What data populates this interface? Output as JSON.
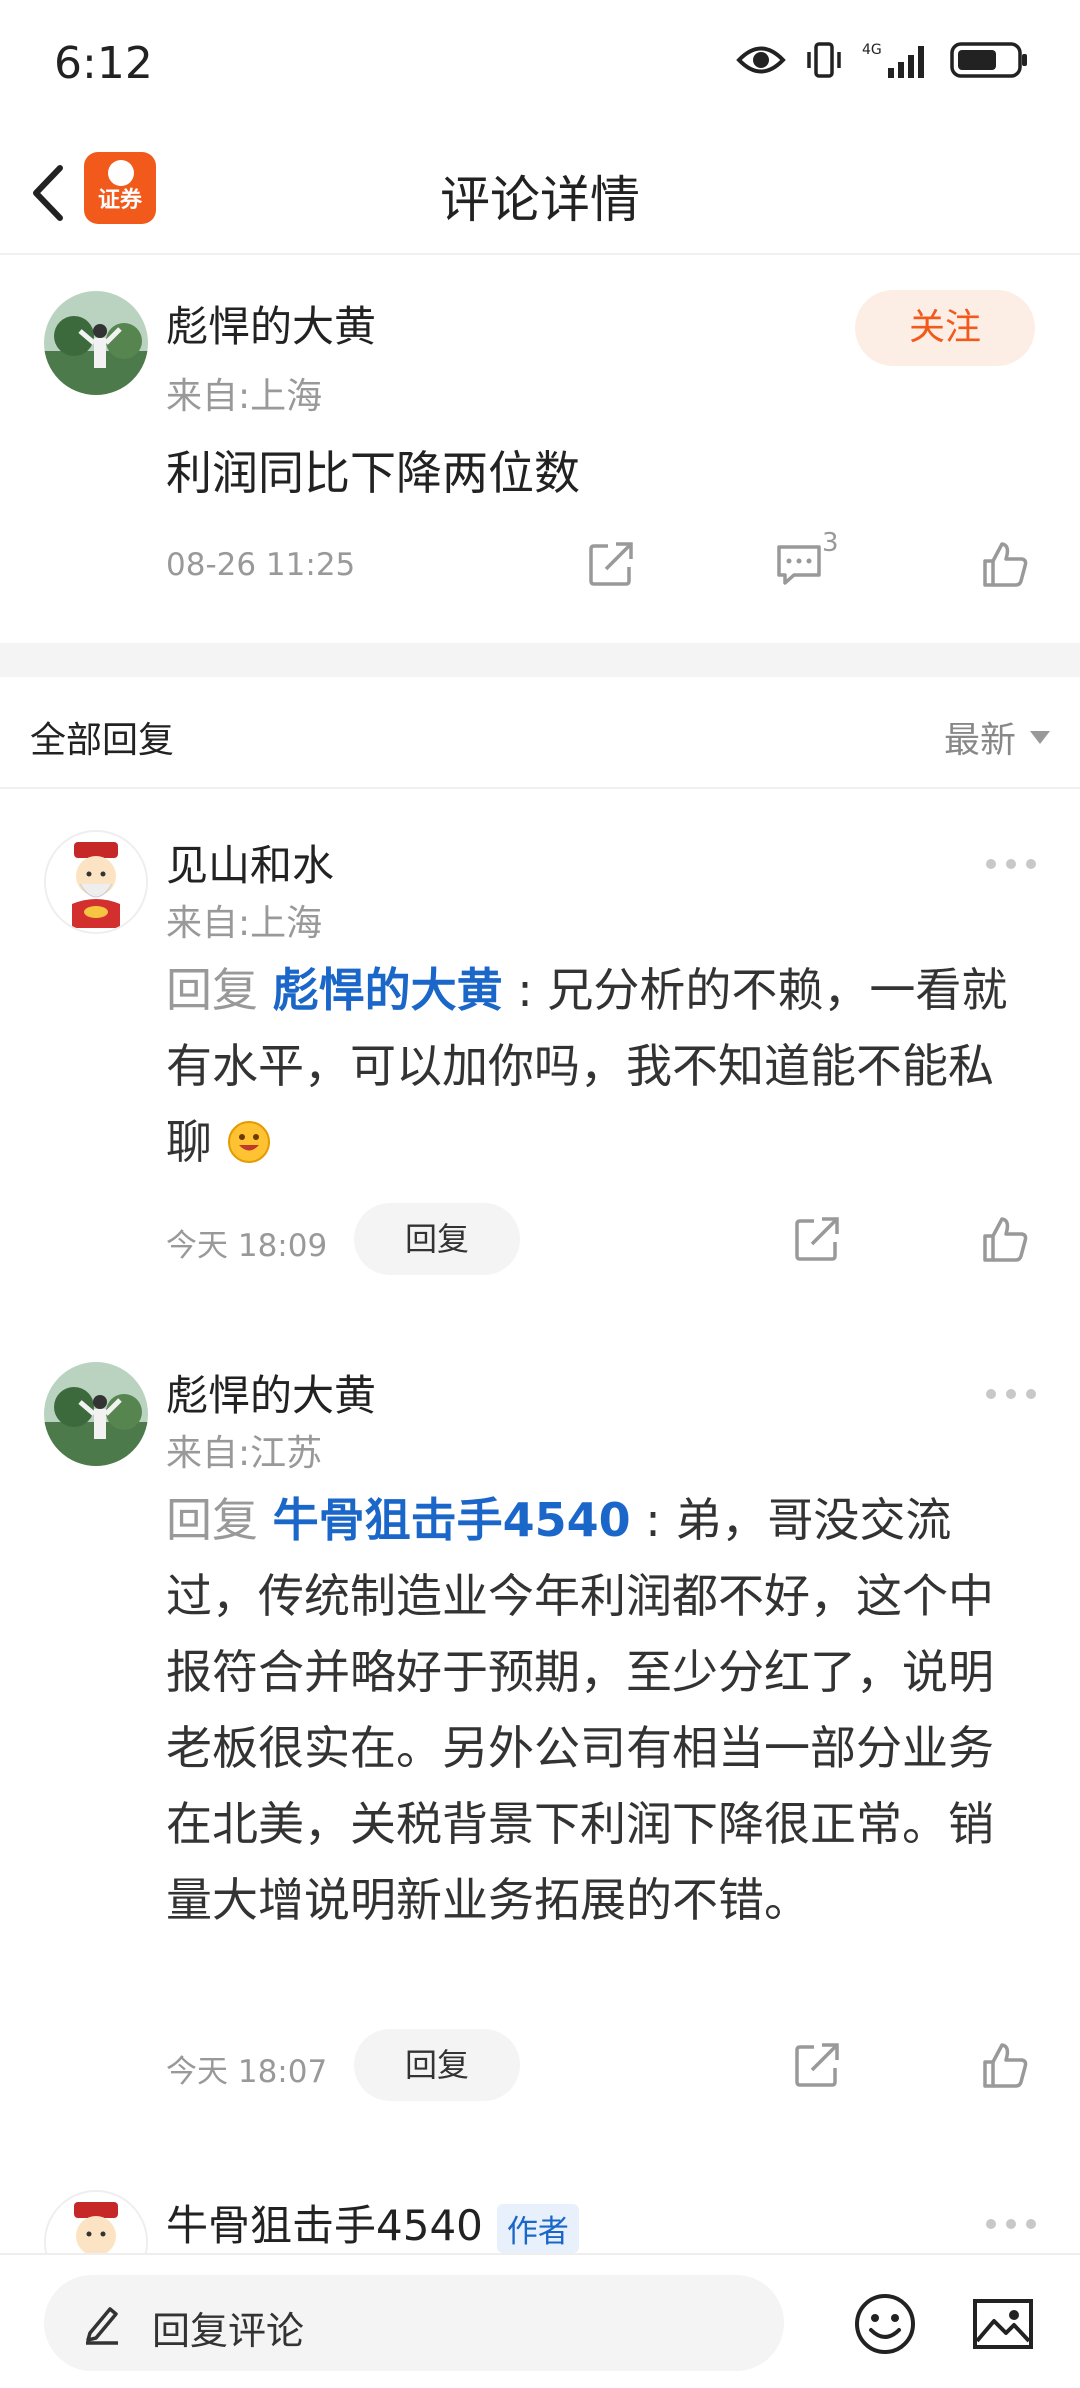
{
  "status": {
    "time": "6:12",
    "network": "4G"
  },
  "header": {
    "title": "评论详情",
    "logo_text": "证券"
  },
  "post": {
    "author": "彪悍的大黄",
    "location": "来自:上海",
    "follow_label": "关注",
    "content": "利润同比下降两位数",
    "time": "08-26 11:25",
    "comment_count": "3"
  },
  "replies_header": {
    "title": "全部回复",
    "sort": "最新"
  },
  "replies": [
    {
      "author": "见山和水",
      "location": "来自:上海",
      "prefix": "回复 ",
      "target": "彪悍的大黄",
      "text": " : 兄分析的不赖，一看就有水平，可以加你吗，我不知道能不能私聊",
      "time": "今天 18:09",
      "reply_label": "回复"
    },
    {
      "author": "彪悍的大黄",
      "location": "来自:江苏",
      "prefix": "回复 ",
      "target": "牛骨狙击手4540",
      "text": " : 弟，哥没交流过，传统制造业今年利润都不好，这个中报符合并略好于预期，至少分红了，说明老板很实在。另外公司有相当一部分业务在北美，关税背景下利润下降很正常。销量大增说明新业务拓展的不错。",
      "time": "今天 18:07",
      "reply_label": "回复"
    },
    {
      "author": "牛骨狙击手4540",
      "author_tag": "作者"
    }
  ],
  "bottom": {
    "placeholder": "回复评论"
  },
  "colors": {
    "accent": "#f25a1c",
    "link": "#1a66c9"
  }
}
